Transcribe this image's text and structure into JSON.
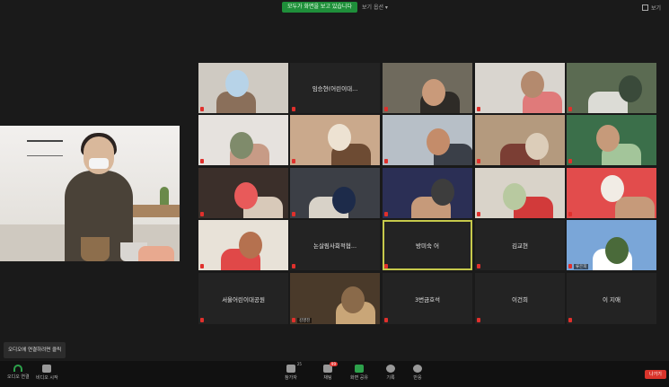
{
  "top": {
    "badge": "모두가 화면을 보고 있습니다",
    "menu": "보기 옵션 ▾",
    "view": "보기"
  },
  "tiles": [
    {
      "name": "",
      "label": ""
    },
    {
      "name": "임승현(어린이대...",
      "label": ""
    },
    {
      "name": "",
      "label": ""
    },
    {
      "name": "",
      "label": ""
    },
    {
      "name": "",
      "label": ""
    },
    {
      "name": "",
      "label": ""
    },
    {
      "name": "",
      "label": ""
    },
    {
      "name": "",
      "label": ""
    },
    {
      "name": "",
      "label": ""
    },
    {
      "name": "",
      "label": ""
    },
    {
      "name": "",
      "label": ""
    },
    {
      "name": "",
      "label": ""
    },
    {
      "name": "",
      "label": ""
    },
    {
      "name": "",
      "label": ""
    },
    {
      "name": "",
      "label": ""
    },
    {
      "name": "",
      "label": ""
    },
    {
      "name": "논살림사회적협...",
      "label": ""
    },
    {
      "name": "방미숙 어",
      "label": ""
    },
    {
      "name": "김교현",
      "label": ""
    },
    {
      "name": "",
      "label": "류은희"
    },
    {
      "name": "서울어린이대공원",
      "label": ""
    },
    {
      "name": "",
      "label": "김영진"
    },
    {
      "name": "3번금호석",
      "label": ""
    },
    {
      "name": "이건희",
      "label": ""
    },
    {
      "name": "이 지애",
      "label": ""
    }
  ],
  "toolbar": {
    "audio": "오디오 연결",
    "video": "비디오 시작",
    "participants": "참가자",
    "participants_count": "25",
    "chat": "채팅",
    "chat_badge": "99",
    "share": "화면 공유",
    "record": "기록",
    "reactions": "반응",
    "leave": "나가기",
    "tooltip": "오디오에 연결하려면 클릭"
  }
}
